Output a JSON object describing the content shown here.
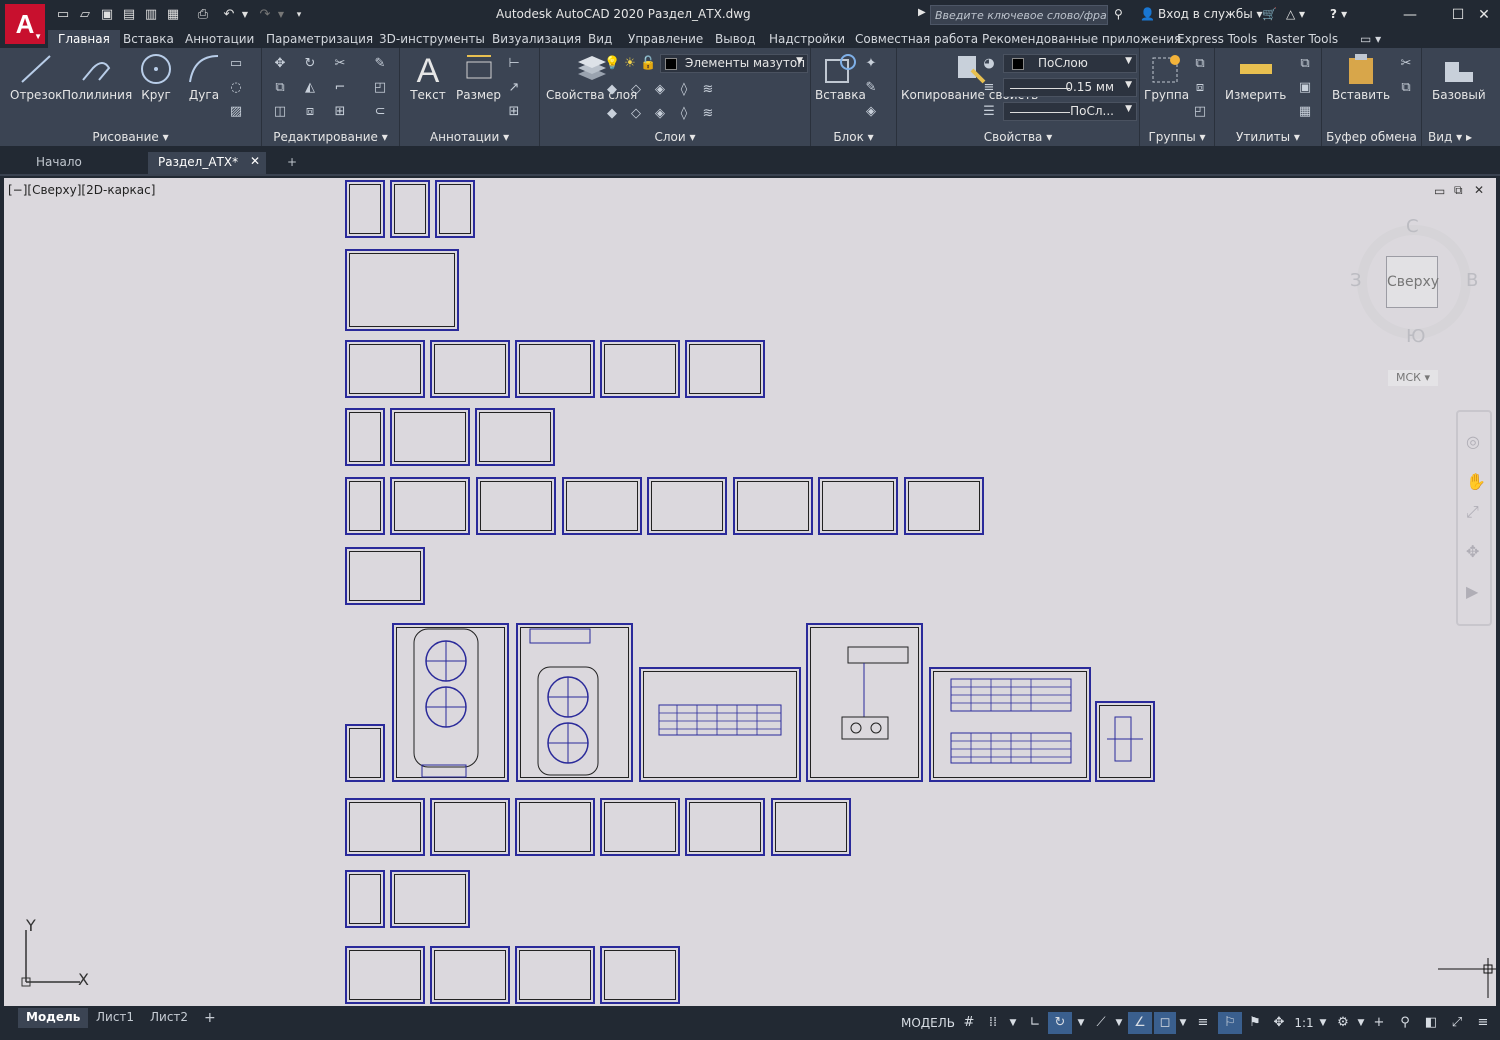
{
  "app": {
    "logo_letter": "A",
    "title": "Autodesk AutoCAD 2020   Раздел_АТХ.dwg"
  },
  "search": {
    "placeholder": "Введите ключевое слово/фразу"
  },
  "titlebar_right": {
    "signin": "Вход в службы",
    "help": "?"
  },
  "menu_tabs": [
    "Главная",
    "Вставка",
    "Аннотации",
    "Параметризация",
    "3D-инструменты",
    "Визуализация",
    "Вид",
    "Управление",
    "Вывод",
    "Надстройки",
    "Совместная работа",
    "Рекомендованные приложения",
    "Express Tools",
    "Raster Tools"
  ],
  "ribbon": {
    "draw": {
      "label": "Рисование",
      "tools": [
        "Отрезок",
        "Полилиния",
        "Круг",
        "Дуга"
      ]
    },
    "modify": {
      "label": "Редактирование"
    },
    "annotation": {
      "label": "Аннотации",
      "tools": [
        "Текст",
        "Размер"
      ]
    },
    "layers": {
      "label": "Слои",
      "layer_props": "Свойства слоя",
      "current_layer": "Элементы мазутоп"
    },
    "block": {
      "label": "Блок",
      "insert": "Вставка"
    },
    "properties": {
      "label": "Свойства",
      "copy_props": "Копирование свойств",
      "color": "ПоСлою",
      "lineweight": "0.15 мм",
      "linetype": "ПоСл..."
    },
    "groups": {
      "label": "Группы",
      "group": "Группа"
    },
    "utilities": {
      "label": "Утилиты",
      "measure": "Измерить"
    },
    "clipboard": {
      "label": "Буфер обмена",
      "paste": "Вставить"
    },
    "view": {
      "label": "Вид",
      "base": "Базовый"
    }
  },
  "doc_tabs": {
    "start": "Начало",
    "active": "Раздел_АТХ*",
    "new": "+"
  },
  "viewport": {
    "label": "[−][Сверху][2D-каркас]"
  },
  "viewcube": {
    "north": "С",
    "south": "Ю",
    "west": "З",
    "east": "В",
    "face": "Сверху",
    "ucs": "МСК"
  },
  "ucs_icon": {
    "x": "X",
    "y": "Y"
  },
  "layout_tabs": [
    "Модель",
    "Лист1",
    "Лист2"
  ],
  "status": {
    "model": "МОДЕЛЬ",
    "scale": "1:1"
  },
  "colors": {
    "background": "#222933",
    "ribbon": "#3b4453",
    "canvas": "#dbd8dd",
    "sheet_border": "#2a2a9a",
    "logo": "#c8102e"
  }
}
